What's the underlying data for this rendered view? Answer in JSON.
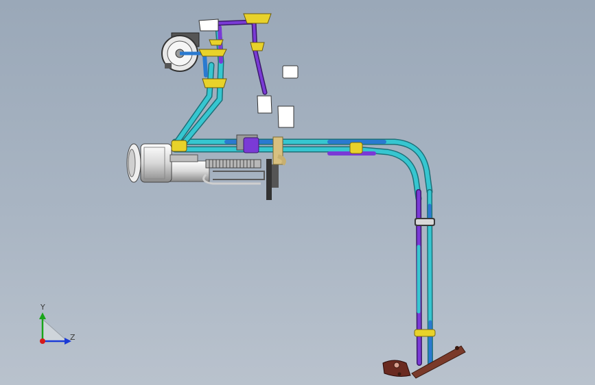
{
  "triad": {
    "y_label": "Y",
    "z_label": "Z",
    "y_color": "#1aa51a",
    "z_color": "#1a3ad6",
    "x_color": "#d61a1a"
  },
  "colors": {
    "tube_cyan": "#36c6d0",
    "tube_blue": "#2a7ad0",
    "tube_purple": "#7a3ad6",
    "clip_yellow": "#e8d22a",
    "bracket_brown": "#7a3a2a",
    "pump_white": "#f2f2f2",
    "pump_grey": "#8a8a8a"
  },
  "icons": [
    "pump-assembly",
    "filter-cartridge",
    "hose-clamp",
    "mounting-bracket",
    "coordinate-triad"
  ]
}
